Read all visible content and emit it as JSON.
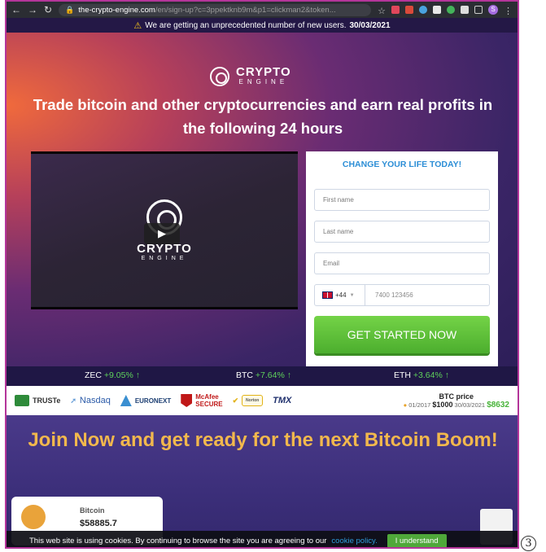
{
  "browser": {
    "url_domain": "the-crypto-engine.com",
    "url_path": "/en/sign-up?c=3ppektknb9m&p1=clickman2&token...",
    "avatar_letter": "S"
  },
  "alert": {
    "text": "We are getting an unprecedented number of new users.",
    "date": "30/03/2021"
  },
  "logo": {
    "line1": "CRYPTO",
    "line2": "ENGINE"
  },
  "headline": "Trade bitcoin and other cryptocurrencies and earn real profits in the following 24 hours",
  "video": {
    "logo_line1": "CRYPTO",
    "logo_line2": "ENGINE",
    "play_icon": "▶"
  },
  "form": {
    "title": "CHANGE YOUR LIFE TODAY!",
    "first_name_placeholder": "First name",
    "last_name_placeholder": "Last name",
    "email_placeholder": "Email",
    "country_code": "+44",
    "phone_placeholder": "7400 123456",
    "submit_label": "GET STARTED NOW"
  },
  "ticker": [
    {
      "symbol": "ZEC",
      "change": "+9.05%"
    },
    {
      "symbol": "BTC",
      "change": "+7.64%"
    },
    {
      "symbol": "ETH",
      "change": "+3.64%"
    }
  ],
  "trust": {
    "truste": "TRUSTe",
    "nasdaq": "Nasdaq",
    "euronext": "EURONEXT",
    "mcafee_line1": "McAfee",
    "mcafee_line2": "SECURE",
    "norton": "Norton",
    "tmx": "TMX",
    "btc_title": "BTC price",
    "btc_old_date": "01/2017",
    "btc_old_price": "$1000",
    "btc_new_date": "30/03/2021",
    "btc_new_price": "$8632"
  },
  "join": {
    "title": "Join Now and get ready for the next Bitcoin Boom!"
  },
  "popup": {
    "name": "Bitcoin",
    "value": "$58885.7"
  },
  "cookie": {
    "text": "This web site is using cookies. By continuing to browse the site you are agreeing to our",
    "link": "cookie policy.",
    "button": "I understand"
  },
  "corner_mark": "3",
  "colors": {
    "accent_green": "#4cae2e",
    "form_title_blue": "#2c8ed6",
    "join_gold": "#f2b84d",
    "frame_border": "#b4359a"
  }
}
